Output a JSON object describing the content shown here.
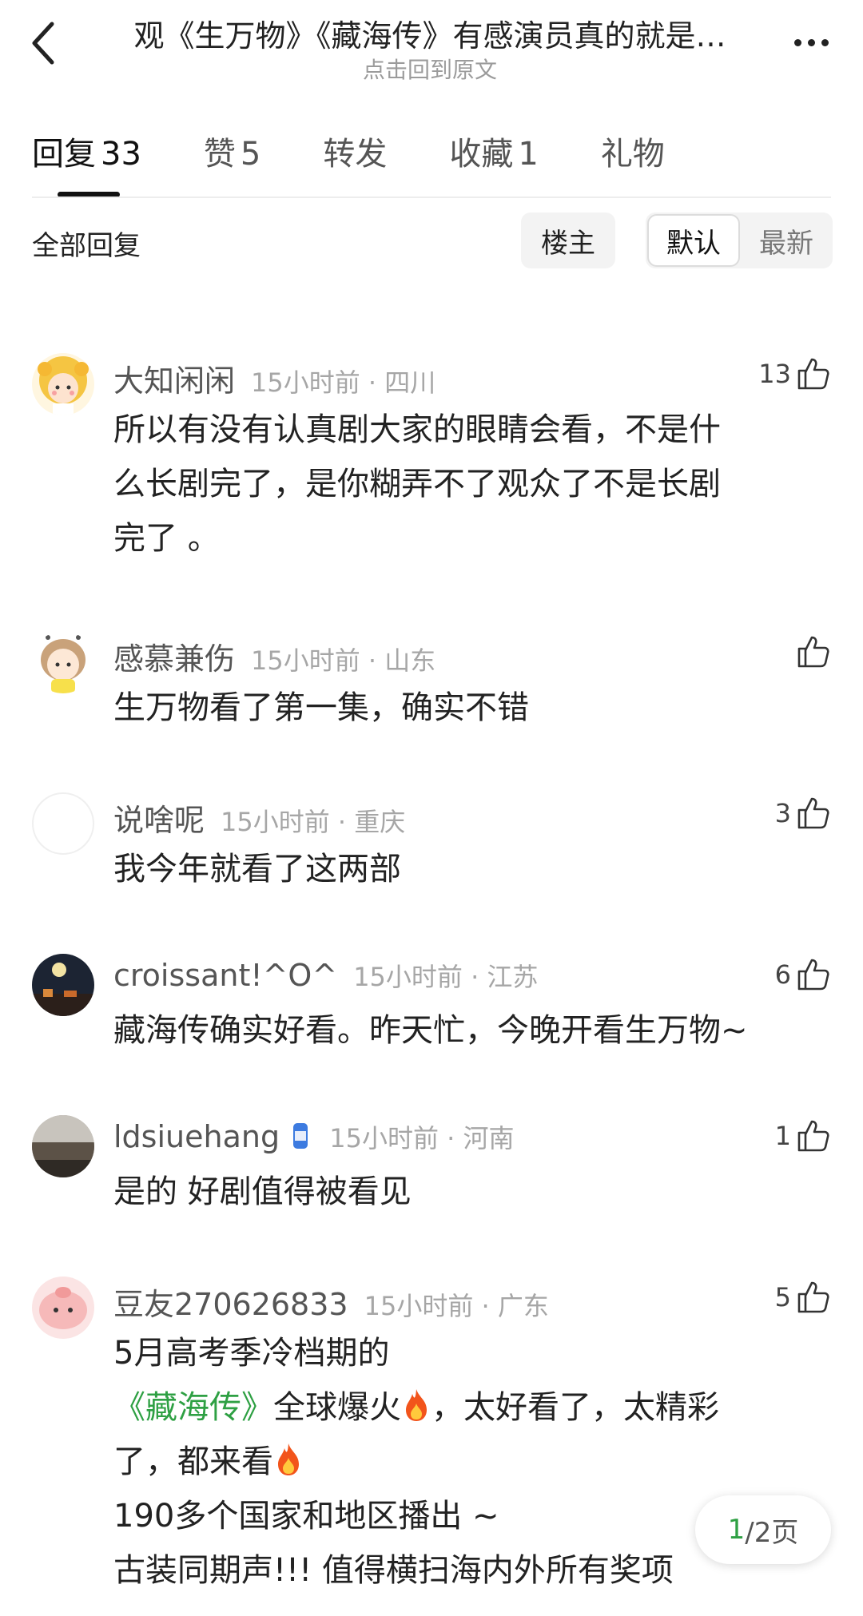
{
  "header": {
    "title": "观《生万物》《藏海传》有感演员真的就是…",
    "subtitle": "点击回到原文"
  },
  "tabs": [
    {
      "label": "回复",
      "count": "33"
    },
    {
      "label": "赞",
      "count": "5"
    },
    {
      "label": "转发",
      "count": ""
    },
    {
      "label": "收藏",
      "count": "1"
    },
    {
      "label": "礼物",
      "count": ""
    }
  ],
  "filter": {
    "all_label": "全部回复",
    "owner_label": "楼主",
    "sort_default": "默认",
    "sort_latest": "最新"
  },
  "comments": [
    {
      "user": "大知闲闲",
      "time": "15小时前 · 四川",
      "likes": "13",
      "text_lines": [
        "所以有没有认真剧大家的眼睛会看，不是什",
        "么长剧完了，是你糊弄不了观众了不是长剧",
        "完了 。"
      ]
    },
    {
      "user": "感慕兼伤",
      "time": "15小时前 · 山东",
      "likes": "",
      "text_lines": [
        "生万物看了第一集，确实不错"
      ]
    },
    {
      "user": "说啥呢",
      "time": "15小时前 · 重庆",
      "likes": "3",
      "text_lines": [
        "我今年就看了这两部"
      ]
    },
    {
      "user": "croissant!^O^",
      "time": "15小时前 · 江苏",
      "likes": "6",
      "text_lines": [
        "藏海传确实好看。昨天忙，今晚开看生万物~"
      ]
    },
    {
      "user": "ldsiuehang",
      "time": "15小时前 · 河南",
      "likes": "1",
      "text_lines": [
        "是的 好剧值得被看见"
      ]
    },
    {
      "user": "豆友270626833",
      "time": "15小时前 · 广东",
      "likes": "5",
      "text_lines": [
        "5月高考季冷档期的",
        "全球爆火",
        "，太好看了，太精彩",
        "了，都来看",
        "190多个国家和地区播出 ~",
        "古装同期声!!! 值得横扫海内外所有奖项"
      ],
      "link": "《藏海传》"
    }
  ],
  "pager": {
    "current": "1",
    "total_suffix": "/2页"
  },
  "colors": {
    "accent_green": "#2ea043",
    "muted": "#a6a6a6"
  }
}
